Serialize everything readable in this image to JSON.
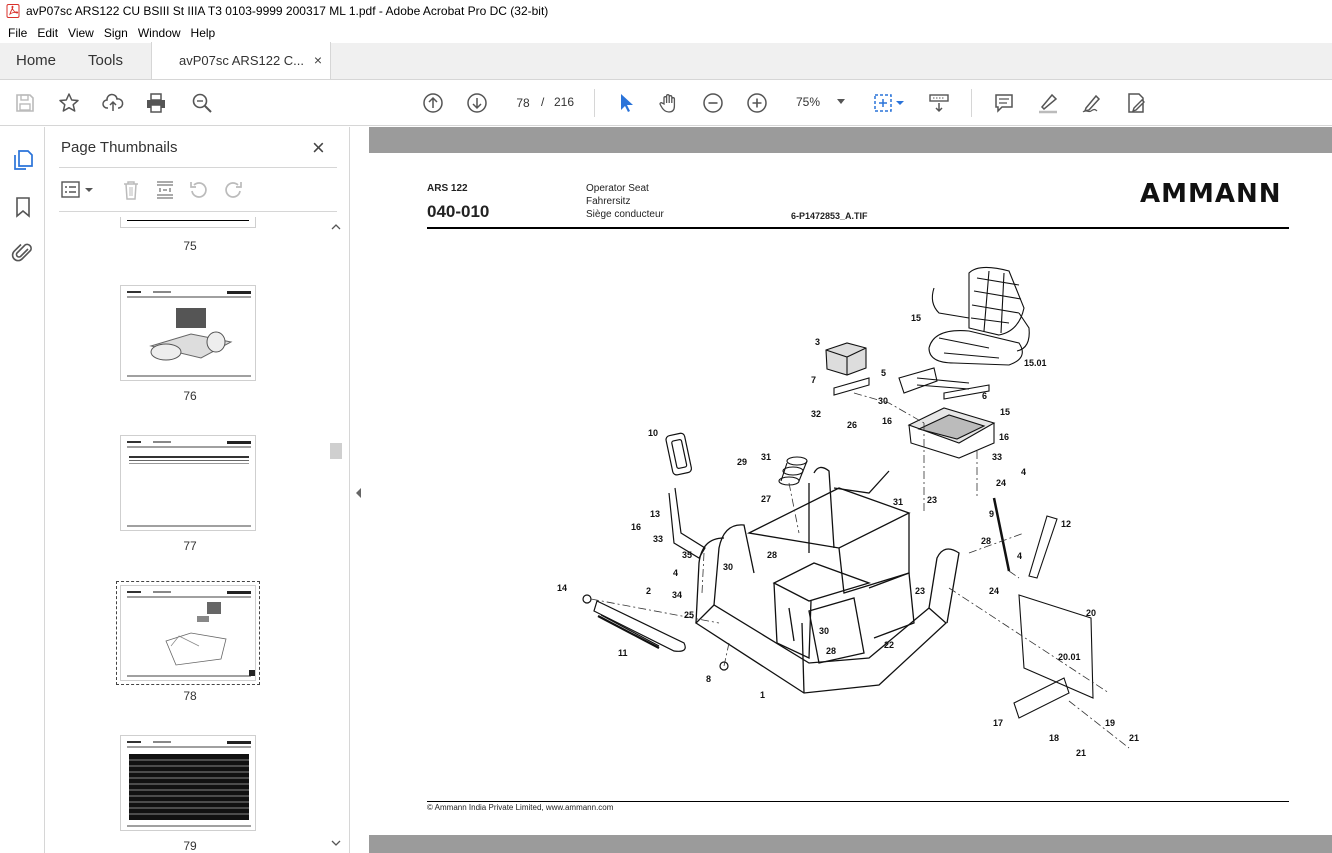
{
  "window": {
    "title": "avP07sc ARS122 CU BSIII St IIIA T3 0103-9999 200317 ML 1.pdf - Adobe Acrobat Pro DC (32-bit)"
  },
  "menu": [
    "File",
    "Edit",
    "View",
    "Sign",
    "Window",
    "Help"
  ],
  "tabs": {
    "home": "Home",
    "tools": "Tools",
    "doc": "avP07sc ARS122 C...",
    "doc_close": "×"
  },
  "nav": {
    "current_page": "78",
    "separator": "/",
    "total_pages": "216",
    "zoom": "75%"
  },
  "panel": {
    "title": "Page Thumbnails",
    "close": "×",
    "thumbnails": [
      {
        "label": "75"
      },
      {
        "label": "76"
      },
      {
        "label": "77"
      },
      {
        "label": "78",
        "selected": true
      },
      {
        "label": "79"
      }
    ]
  },
  "document": {
    "model": "ARS 122",
    "code": "040-010",
    "title_en": "Operator Seat",
    "title_de": "Fahrersitz",
    "title_fr": "Siège conducteur",
    "file_ref": "6-P1472853_A.TIF",
    "brand": "AMMANN",
    "footer": "© Ammann India Private Limited, www.ammann.com",
    "callouts": [
      "1",
      "2",
      "3",
      "4",
      "4",
      "4",
      "5",
      "6",
      "7",
      "8",
      "9",
      "10",
      "11",
      "12",
      "13",
      "14",
      "15",
      "15",
      "15.01",
      "16",
      "16",
      "16",
      "17",
      "18",
      "19",
      "20",
      "20.01",
      "21",
      "21",
      "22",
      "23",
      "23",
      "24",
      "24",
      "25",
      "26",
      "27",
      "28",
      "28",
      "28",
      "29",
      "30",
      "30",
      "30",
      "31",
      "31",
      "32",
      "33",
      "33",
      "34",
      "35"
    ]
  }
}
